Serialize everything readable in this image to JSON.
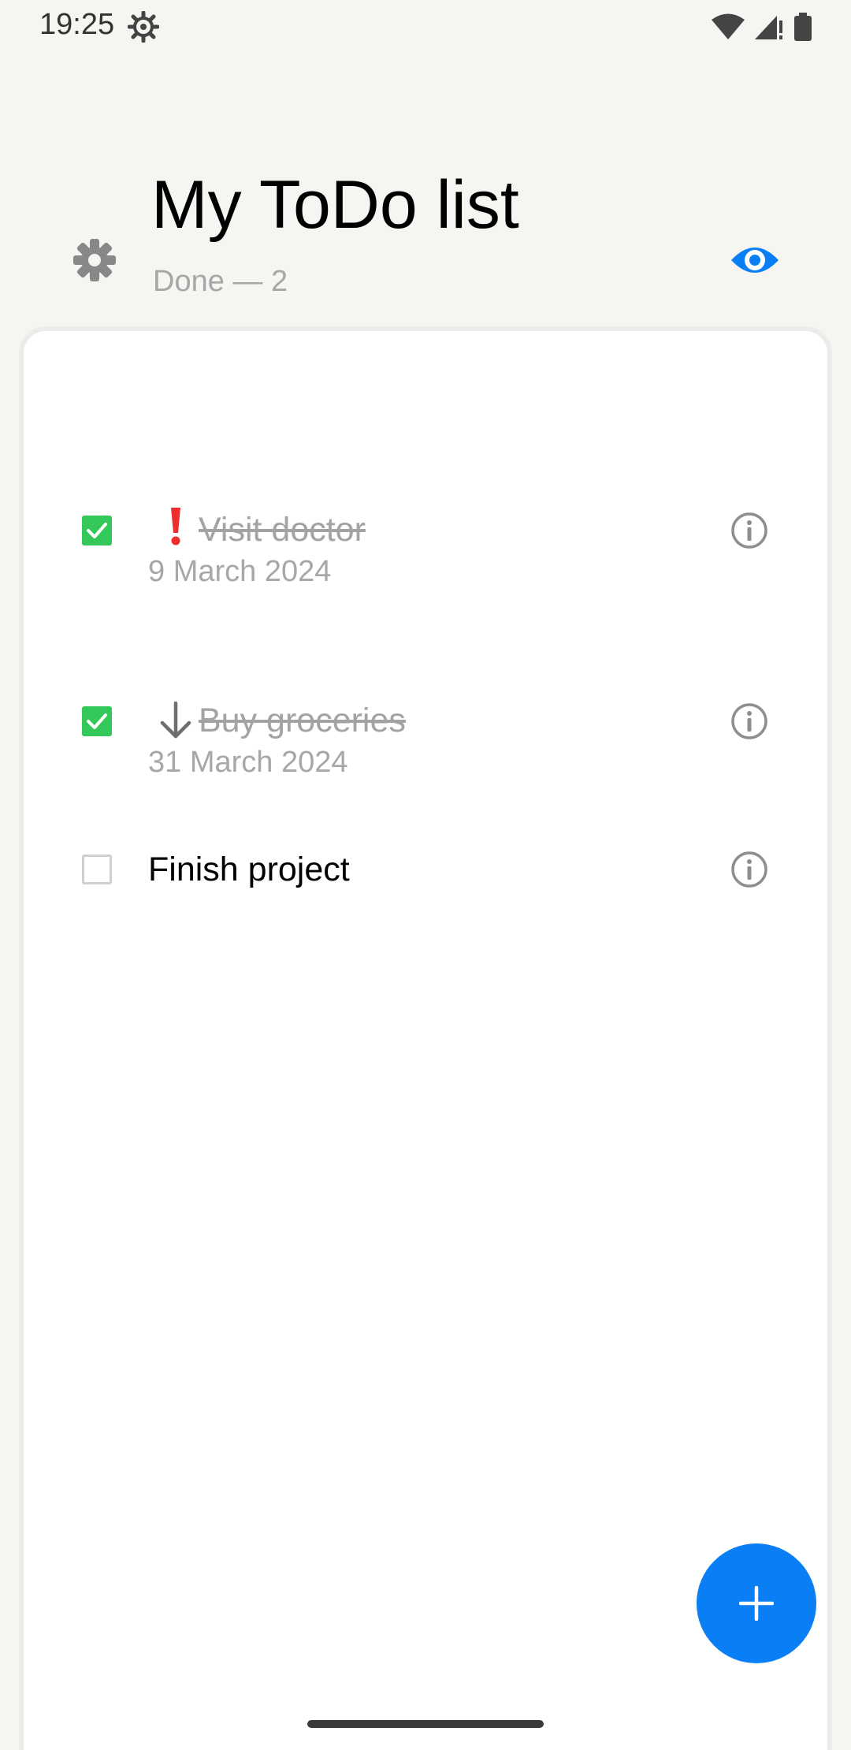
{
  "status_bar": {
    "time": "19:25",
    "icons": [
      "settings-gear-icon",
      "wifi-icon",
      "signal-icon",
      "battery-icon"
    ]
  },
  "header": {
    "title": "My ToDo list",
    "done_summary": "Done — 2",
    "settings_icon": "gear-icon",
    "visibility_icon": "eye-icon"
  },
  "tasks": [
    {
      "title": "Visit doctor",
      "date": "9 March 2024",
      "done": true,
      "priority_icon": "exclamation-icon"
    },
    {
      "title": "Buy groceries",
      "date": "31 March 2024",
      "done": true,
      "priority_icon": "arrow-down-icon"
    },
    {
      "title": "Finish project",
      "date": "",
      "done": false,
      "priority_icon": ""
    }
  ],
  "fab": {
    "icon": "plus-icon"
  },
  "colors": {
    "accent": "#0a7ef4",
    "check": "#34c85a",
    "priority_high": "#ee2e2e",
    "muted_text": "#a7a7a7",
    "background": "#f6f5f2"
  }
}
